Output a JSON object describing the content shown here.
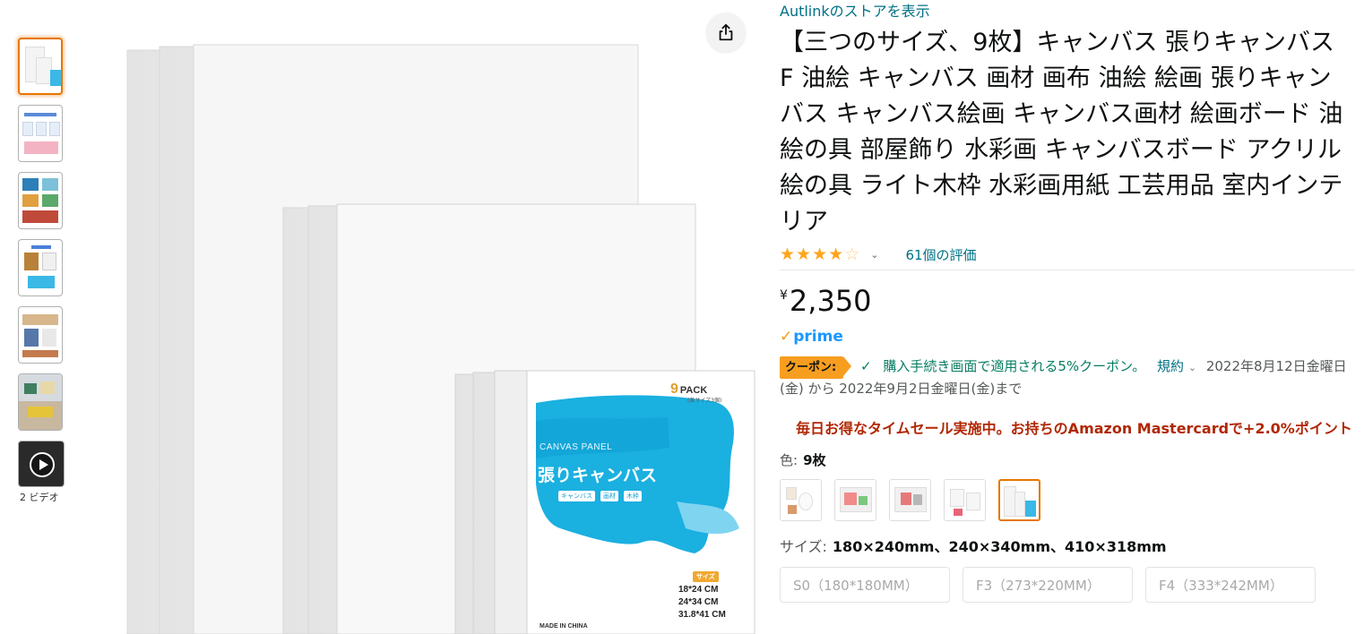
{
  "thumbnails": [
    {
      "label": "thumb-1",
      "selected": true
    },
    {
      "label": "thumb-2",
      "selected": false
    },
    {
      "label": "thumb-3",
      "selected": false
    },
    {
      "label": "thumb-4",
      "selected": false
    },
    {
      "label": "thumb-5",
      "selected": false
    },
    {
      "label": "thumb-6",
      "selected": false
    }
  ],
  "video_label": "2 ビデオ",
  "main_image": {
    "pack_count_digit": "9",
    "pack_word": "PACK",
    "pack_sub": "(各サイズ3個)",
    "panel_en": "CANVAS PANEL",
    "panel_jp": "張りキャンバス",
    "tags": [
      "キャンバス",
      "画材",
      "木枠"
    ],
    "size_badge": "サイズ",
    "sizes": [
      "18*24 CM",
      "24*34 CM",
      "31.8*41 CM"
    ],
    "made_in": "MADE IN CHINA"
  },
  "store_link": "Autlinkのストアを表示",
  "title": "【三つのサイズ、9枚】キャンバス 張りキャンバス F 油絵 キャンバス 画材 画布 油絵 絵画 張りキャンバス キャンバス絵画 キャンバス画材 絵画ボード 油絵の具 部屋飾り 水彩画 キャンバスボード アクリル絵の具 ライト木枠 水彩画用紙 工芸用品 室内インテリア",
  "rating": {
    "stars": 4,
    "max": 5,
    "count_text": "61個の評価"
  },
  "price": {
    "symbol": "¥",
    "amount": "2,350"
  },
  "prime_text": "prime",
  "coupon": {
    "badge": "クーポン:",
    "text": "購入手続き画面で適用される5%クーポン。",
    "terms": "規約",
    "period": "2022年8月12日金曜日(金) から 2022年9月2日金曜日(金)まで"
  },
  "deal_message": "毎日お得なタイムセール実施中。お持ちのAmazon Mastercardで+2.0%ポイント",
  "color": {
    "label": "色:",
    "value": "9枚",
    "swatch_count": 5,
    "selected_index": 4
  },
  "size": {
    "label": "サイズ:",
    "value": "180×240mm、240×340mm、410×318mm",
    "options": [
      "S0（180*180MM）",
      "F3（273*220MM）",
      "F4（333*242MM）"
    ]
  },
  "colors": {
    "link": "#007185",
    "price_red": "#B12704",
    "coupon_orange": "#F79E20",
    "coupon_green": "#067D62",
    "star": "#FFA41C",
    "prime_blue": "#1a98ff",
    "brush_blue": "#1ab0e0"
  }
}
